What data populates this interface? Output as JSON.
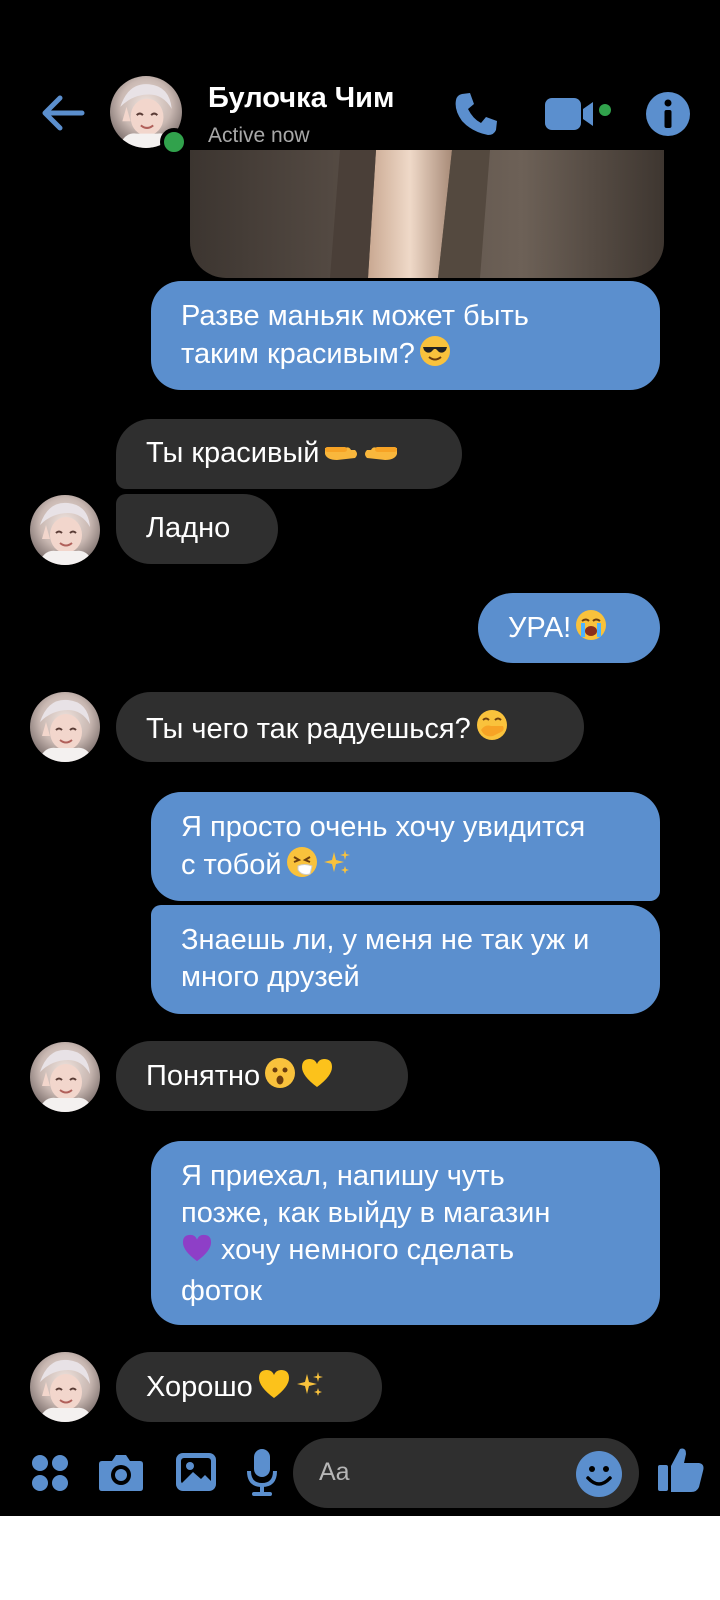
{
  "header": {
    "contact_name": "Булочка Чим",
    "status": "Active now"
  },
  "messages": [
    {
      "direction": "outgoing",
      "lines": [
        "Разве маньяк может быть",
        "таким красивым?"
      ],
      "emoji": "smiling-face-with-sunglasses"
    },
    {
      "direction": "incoming",
      "lines": [
        "Ты красивый"
      ],
      "emoji": "backhand-index-pointing-right-left"
    },
    {
      "direction": "incoming",
      "lines": [
        "Ладно"
      ]
    },
    {
      "direction": "outgoing",
      "lines": [
        "УРА!"
      ],
      "emoji": "loudly-crying-face"
    },
    {
      "direction": "incoming",
      "lines": [
        "Ты чего так радуешься?"
      ],
      "emoji": "face-with-hand-over-mouth"
    },
    {
      "direction": "outgoing",
      "lines": [
        "Я просто очень хочу увидится",
        "с тобой"
      ],
      "emoji": "sneezing-face sparkles"
    },
    {
      "direction": "outgoing",
      "lines": [
        "Знаешь ли, у меня не так уж и",
        "много друзей"
      ]
    },
    {
      "direction": "incoming",
      "lines": [
        "Понятно"
      ],
      "emoji": "hushed-face yellow-heart"
    },
    {
      "direction": "outgoing",
      "lines": [
        "Я приехал, напишу чуть",
        "позже, как выйду в магазин",
        "хочу немного сделать",
        "фоток"
      ],
      "emoji": "purple-heart"
    },
    {
      "direction": "incoming",
      "lines": [
        "Хорошо"
      ],
      "emoji": "yellow-heart sparkles"
    }
  ],
  "composer": {
    "placeholder": "Aa",
    "icons": [
      "grid-menu-icon",
      "camera-icon",
      "gallery-icon",
      "microphone-icon",
      "emoji-icon",
      "like-icon"
    ]
  },
  "colors": {
    "accent": "#5b8fce",
    "outgoing_bubble": "#5b8fce",
    "incoming_bubble": "#2f2f2f",
    "background": "#000000",
    "online": "#31a24c"
  }
}
